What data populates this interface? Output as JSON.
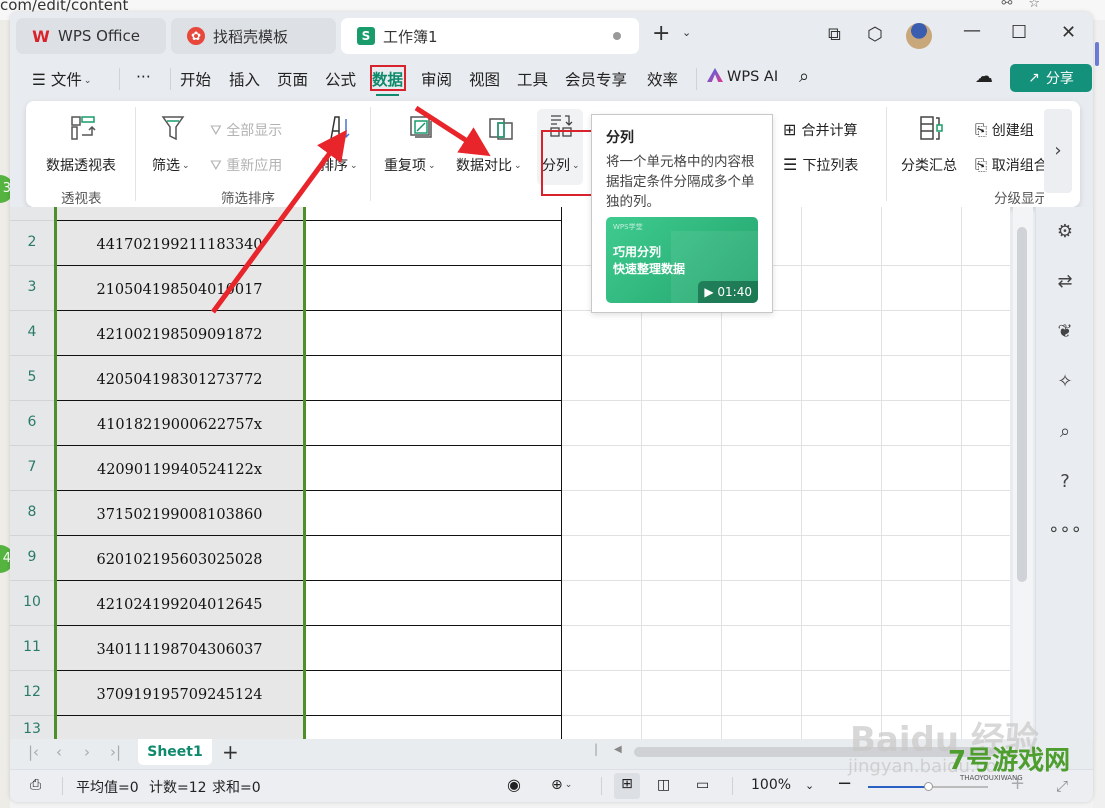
{
  "browser": {
    "url_fragment": "com/edit/content"
  },
  "titlebar": {
    "tabs": [
      {
        "label": "WPS Office",
        "icon": "wps-logo-icon",
        "active": false
      },
      {
        "label": "找稻壳模板",
        "icon": "docer-icon",
        "active": false
      },
      {
        "label": "工作簿1",
        "icon": "spreadsheet-s-icon",
        "icon_text": "S",
        "active": true
      }
    ],
    "new_tab": "+",
    "window_controls": [
      "minimize",
      "maximize",
      "close"
    ]
  },
  "menu": {
    "file_label": "文件",
    "more_label": "···",
    "items": [
      "开始",
      "插入",
      "页面",
      "公式",
      "数据",
      "审阅",
      "视图",
      "工具",
      "会员专享",
      "效率"
    ],
    "active": "数据",
    "ai_label": "WPS AI",
    "share_label": "分享"
  },
  "ribbon": {
    "pivot": {
      "button": "数据透视表",
      "group": "透视表"
    },
    "filter_sort": {
      "filter": "筛选",
      "show_all": "全部显示",
      "reapply": "重新应用",
      "sort": "排序",
      "group": "筛选排序"
    },
    "duplicates": "重复项",
    "compare": "数据对比",
    "split_column": "分列",
    "consolidate": "合并计算",
    "dropdown_list": "下拉列表",
    "subtotal": "分类汇总",
    "create_group": "创建组",
    "ungroup": "取消组合",
    "outline_group": "分级显示"
  },
  "tooltip": {
    "title": "分列",
    "description": "将一个单元格中的内容根据指定条件分隔成多个单独的列。",
    "video": {
      "brand": "WPS学堂",
      "line1": "巧用分列",
      "line2": "快速整理数据",
      "duration": "01:40"
    }
  },
  "sheet": {
    "rows": [
      {
        "num": "2",
        "value": "441702199211183340"
      },
      {
        "num": "3",
        "value": "210504198504010017"
      },
      {
        "num": "4",
        "value": "421002198509091872"
      },
      {
        "num": "5",
        "value": "420504198301273772"
      },
      {
        "num": "6",
        "value": "41018219000622757x"
      },
      {
        "num": "7",
        "value": "42090119940524122x"
      },
      {
        "num": "8",
        "value": "371502199008103860"
      },
      {
        "num": "9",
        "value": "620102195603025028"
      },
      {
        "num": "10",
        "value": "421024199204012645"
      },
      {
        "num": "11",
        "value": "340111198704306037"
      },
      {
        "num": "12",
        "value": "370919195709245124"
      },
      {
        "num": "13",
        "value": ""
      }
    ],
    "tab_name": "Sheet1",
    "add_sheet": "+"
  },
  "statusbar": {
    "average": "平均值=0",
    "count": "计数=12",
    "sum": "求和=0",
    "zoom": "100%",
    "zoom_fraction": 0.5
  },
  "annotations": {
    "step_badges": [
      "3",
      "4"
    ],
    "watermark_baidu": "Baidu 经验",
    "watermark_baidu_sub": "jingyan.baidu.com",
    "watermark_site": "7号游戏网",
    "watermark_site_sub": "THAOYOUXIWANG"
  }
}
